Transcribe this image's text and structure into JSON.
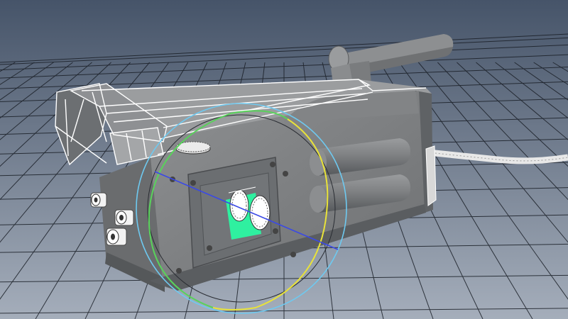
{
  "viewport": {
    "colors": {
      "background_top": "#465469",
      "background_bottom": "#a5aebb",
      "grid_line": "#1a1f27",
      "model_body": "#8a8c8e",
      "model_dark": "#5d6063",
      "selection_wireframe": "#ffffff",
      "selected_component": "#2ff0a0",
      "rotate_ring_outer": "#6ec9f0",
      "rotate_ring_x": "#e8e23a",
      "rotate_ring_y": "#59d25b",
      "rotate_axis": "#3a49e6"
    },
    "tool": "rotate-manipulator"
  }
}
